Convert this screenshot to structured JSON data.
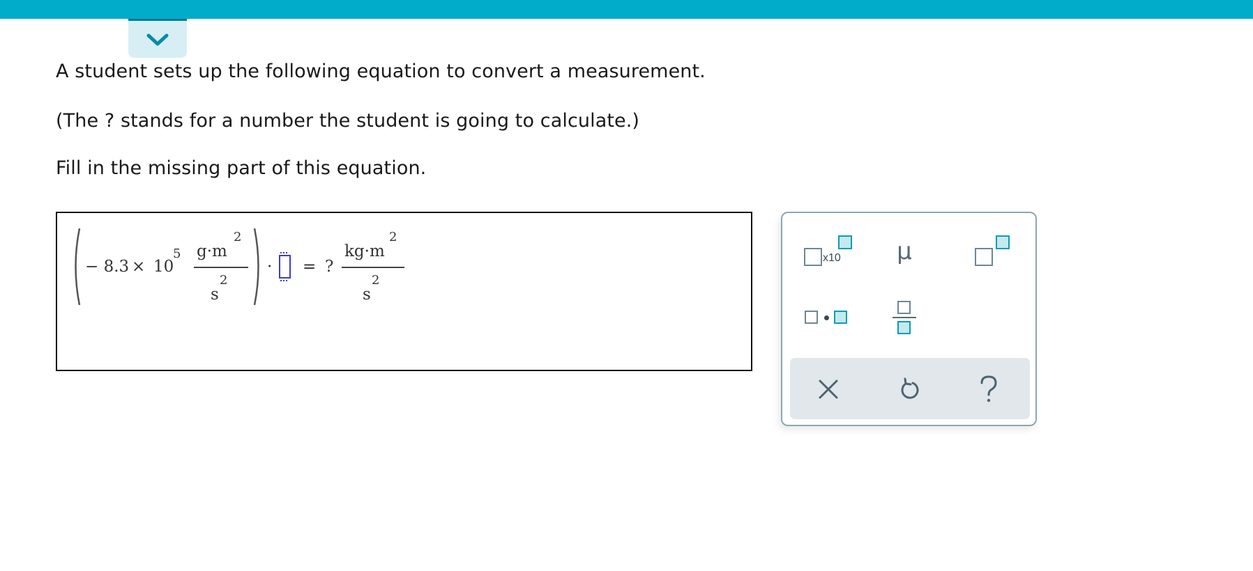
{
  "header": {
    "collapse_icon": "chevron-down-icon",
    "accent_color": "#00acca"
  },
  "question": {
    "line1": "A student sets up the following equation to convert a measurement.",
    "line2": "(The ? stands for a number the student is going to calculate.)",
    "line3": "Fill in the missing part of this equation."
  },
  "equation": {
    "coefficient": "− 8.3",
    "times": "×",
    "base": "10",
    "exponent": "5",
    "lhs_unit_num": "g·m",
    "lhs_unit_num_exp": "2",
    "lhs_unit_den": "s",
    "lhs_unit_den_exp": "2",
    "dot": "·",
    "equals": "=",
    "unknown": "?",
    "rhs_unit_num": "kg·m",
    "rhs_unit_num_exp": "2",
    "rhs_unit_den": "s",
    "rhs_unit_den_exp": "2"
  },
  "palette": {
    "sci_notation_label": "x10",
    "mu_symbol": "μ",
    "buttons": [
      "scientific-notation",
      "micro",
      "superscript",
      "multiply-dot",
      "fraction"
    ],
    "footer": [
      "clear-icon",
      "undo-icon",
      "help-icon"
    ]
  }
}
